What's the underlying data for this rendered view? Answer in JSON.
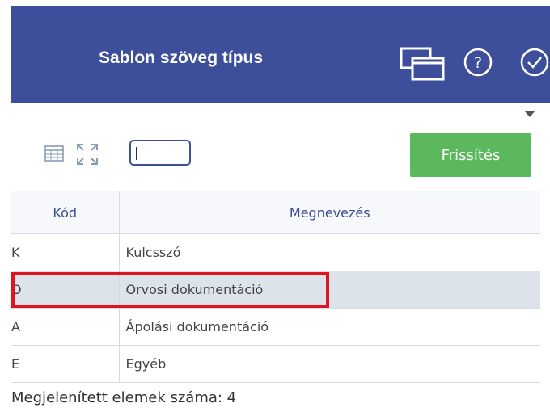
{
  "header": {
    "title": "Sablon szöveg típus",
    "background": "#3d4f9a",
    "icons": [
      "windows-icon",
      "help-icon",
      "check-icon"
    ]
  },
  "toolbar": {
    "filter_value": "",
    "refresh_label": "Frissítés",
    "refresh_color": "#5cb85c"
  },
  "table": {
    "columns": [
      "Kód",
      "Megnevezés"
    ],
    "rows": [
      {
        "kod": "K",
        "name": "Kulcsszó",
        "selected": false
      },
      {
        "kod": "O",
        "name": "Orvosi dokumentáció",
        "selected": true
      },
      {
        "kod": "A",
        "name": "Ápolási dokumentáció",
        "selected": false
      },
      {
        "kod": "E",
        "name": "Egyéb",
        "selected": false
      }
    ]
  },
  "footer": {
    "count_text": "Megjelenített elemek száma: 4"
  },
  "highlight_color": "#e0141e"
}
